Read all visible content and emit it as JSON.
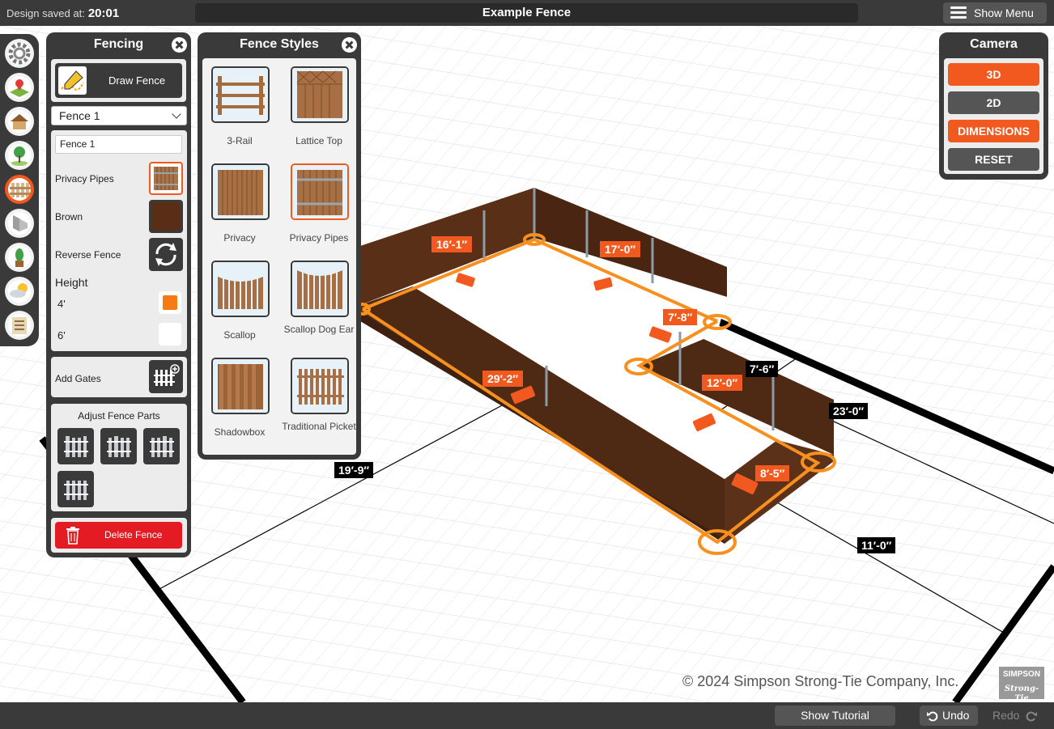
{
  "header": {
    "saved_label": "Design saved at:",
    "saved_time": "20:01",
    "title": "Example Fence",
    "menu_label": "Show Menu"
  },
  "left_tools": [
    {
      "icon": "settings-gear-icon"
    },
    {
      "icon": "map-location-icon"
    },
    {
      "icon": "house-icon"
    },
    {
      "icon": "tree-icon"
    },
    {
      "icon": "fence-icon",
      "active": true
    },
    {
      "icon": "pipe-fitting-icon"
    },
    {
      "icon": "plant-icon"
    },
    {
      "icon": "weather-icon"
    },
    {
      "icon": "list-notes-icon"
    }
  ],
  "fencing": {
    "title": "Fencing",
    "draw_label": "Draw Fence",
    "fence_select": "Fence 1",
    "fence_name": "Fence 1",
    "style_label": "Privacy Pipes",
    "color_label": "Brown",
    "color_hex": "#5a2d17",
    "reverse_label": "Reverse Fence",
    "height_label": "Height",
    "heights": [
      "4'",
      "6'"
    ],
    "selected_height": "4'",
    "gates_label": "Add Gates",
    "adjust_label": "Adjust Fence Parts",
    "delete_label": "Delete Fence"
  },
  "styles": {
    "title": "Fence Styles",
    "items": [
      {
        "label": "3-Rail"
      },
      {
        "label": "Lattice Top"
      },
      {
        "label": "Privacy"
      },
      {
        "label": "Privacy Pipes",
        "selected": true
      },
      {
        "label": "Scallop"
      },
      {
        "label": "Scallop Dog Ear"
      },
      {
        "label": "Shadowbox"
      },
      {
        "label": "Traditional Picket"
      }
    ]
  },
  "camera": {
    "title": "Camera",
    "buttons": [
      {
        "label": "3D",
        "active": true
      },
      {
        "label": "2D",
        "active": false
      },
      {
        "label": "DIMENSIONS",
        "active": true
      },
      {
        "label": "RESET",
        "active": false
      }
    ]
  },
  "scene": {
    "segment_labels": [
      "16′-1″",
      "17′-0″",
      "7′-8″",
      "12′-0″",
      "29′-2″",
      "8′-5″"
    ],
    "dimension_labels": [
      "7′-6″",
      "23′-0″",
      "19′-9″",
      "11′-0″"
    ],
    "accent": "#f2591e",
    "fence_color": "#4e2a14"
  },
  "footer": {
    "copyright": "© 2024 Simpson Strong-Tie Company, Inc.",
    "brand_top": "SIMPSON",
    "brand_bottom": "Strong-Tie",
    "tutorial": "Show Tutorial",
    "undo": "Undo",
    "redo": "Redo"
  }
}
